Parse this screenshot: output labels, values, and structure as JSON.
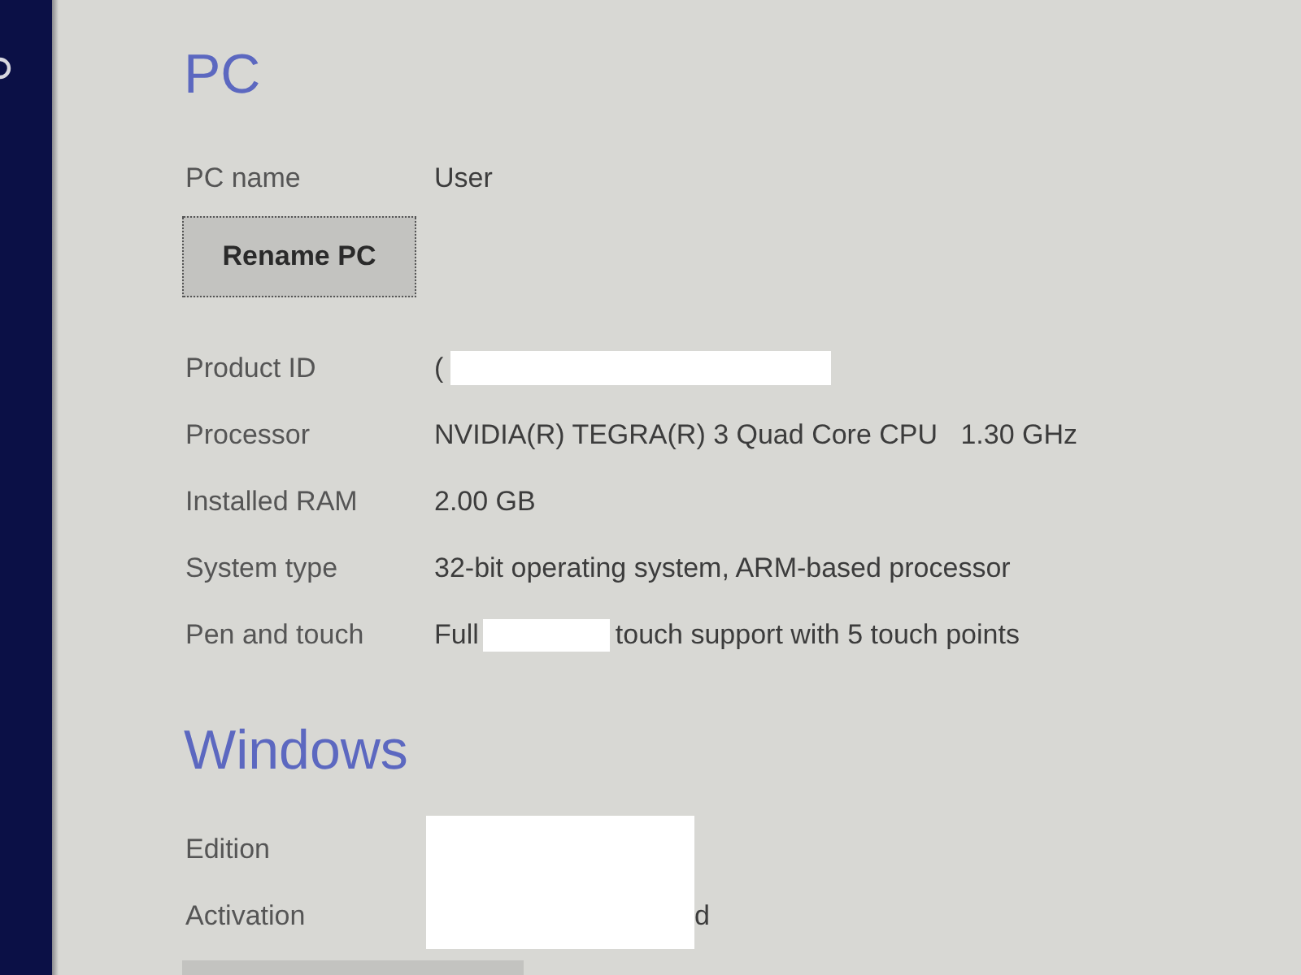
{
  "sections": [
    {
      "title": "PC",
      "name_row": {
        "label": "PC name",
        "value": "User"
      },
      "button": {
        "label": "Rename PC",
        "focused": true
      },
      "rows": [
        {
          "label": "Product ID",
          "parts": [
            {
              "kind": "text",
              "text": "("
            },
            {
              "kind": "redaction"
            }
          ]
        },
        {
          "label": "Processor",
          "parts": [
            {
              "kind": "text",
              "text": "NVIDIA(R) TEGRA(R) 3 Quad Core CPU   1.30 GHz"
            }
          ]
        },
        {
          "label": "Installed RAM",
          "parts": [
            {
              "kind": "text",
              "text": "2.00 GB"
            }
          ]
        },
        {
          "label": "System type",
          "parts": [
            {
              "kind": "text",
              "text": "32-bit operating system, ARM-based processor"
            }
          ]
        },
        {
          "label": "Pen and touch",
          "parts": [
            {
              "kind": "text",
              "text": "Full"
            },
            {
              "kind": "redaction"
            },
            {
              "kind": "text",
              "text": "touch support with 5 touch points"
            }
          ]
        }
      ]
    },
    {
      "title": "Windows",
      "rows": [
        {
          "label": "Edition",
          "parts": [
            {
              "kind": "redaction"
            }
          ]
        },
        {
          "label": "Activation",
          "parts": [
            {
              "kind": "redaction"
            },
            {
              "kind": "text",
              "text": "d"
            }
          ]
        }
      ]
    }
  ]
}
